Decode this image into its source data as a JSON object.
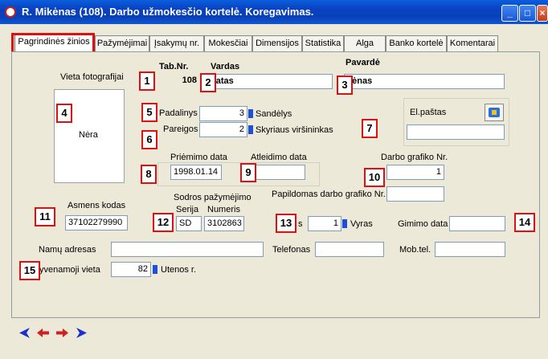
{
  "window": {
    "title": "R. Mikėnas  (108).  Darbo užmokesčio kortelė. Koregavimas.",
    "min": "_",
    "max": "□",
    "close": "×"
  },
  "tabs": [
    "Pagrindinės žinios",
    "Pažymėjimai",
    "Įsakymų nr.",
    "Mokesčiai",
    "Dimensijos",
    "Statistika",
    "Alga",
    "Banko kortelė",
    "Komentarai"
  ],
  "photo": {
    "label": "Vieta fotografijai",
    "placeholder": "Nėra"
  },
  "tabnr": {
    "label": "Tab.Nr.",
    "value": "108"
  },
  "vardas": {
    "label": "Vardas",
    "value": "natas"
  },
  "pavarde": {
    "label": "Pavardė",
    "value": "kėnas"
  },
  "padalinys": {
    "label": "Padalinys",
    "value": "3",
    "text": "Sandėlys"
  },
  "pareigos": {
    "label": "Pareigos",
    "value": "2",
    "text": "Skyriaus viršininkas"
  },
  "email": {
    "label": "El.paštas",
    "value": ""
  },
  "priemimo": {
    "label": "Priėmimo data",
    "value": "1998.01.14"
  },
  "atleidimo": {
    "label": "Atleidimo data",
    "value": ""
  },
  "grafikas": {
    "label": "Darbo grafiko Nr.",
    "value": "1"
  },
  "papildomas": {
    "label": "Papildomas darbo grafiko Nr.",
    "value": ""
  },
  "asmens": {
    "label": "Asmens kodas",
    "value": "37102279990"
  },
  "sodra": {
    "label": "Sodros pažymėjimo",
    "serija_label": "Serija",
    "numeris_label": "Numeris",
    "serija": "SD",
    "numeris": "3102863"
  },
  "lytis": {
    "label": "s",
    "value": "1",
    "text": "Vyras"
  },
  "gimimo": {
    "label": "Gimimo data",
    "value": ""
  },
  "adresas": {
    "label": "Namų adresas",
    "value": ""
  },
  "telefonas": {
    "label": "Telefonas",
    "value": ""
  },
  "mobtel": {
    "label": "Mob.tel.",
    "value": ""
  },
  "gyvenamoji": {
    "label": "yvenamoji vieta",
    "value": "82",
    "text": "Utenos r."
  },
  "markers": [
    "1",
    "2",
    "3",
    "4",
    "5",
    "6",
    "7",
    "8",
    "9",
    "10",
    "11",
    "12",
    "13",
    "14",
    "15"
  ],
  "colors": {
    "marker_border": "#e01010",
    "title_bar": "#0a3fc0",
    "nav_arrow": "#1c2fd0",
    "nav_arrow_red": "#d02020"
  }
}
